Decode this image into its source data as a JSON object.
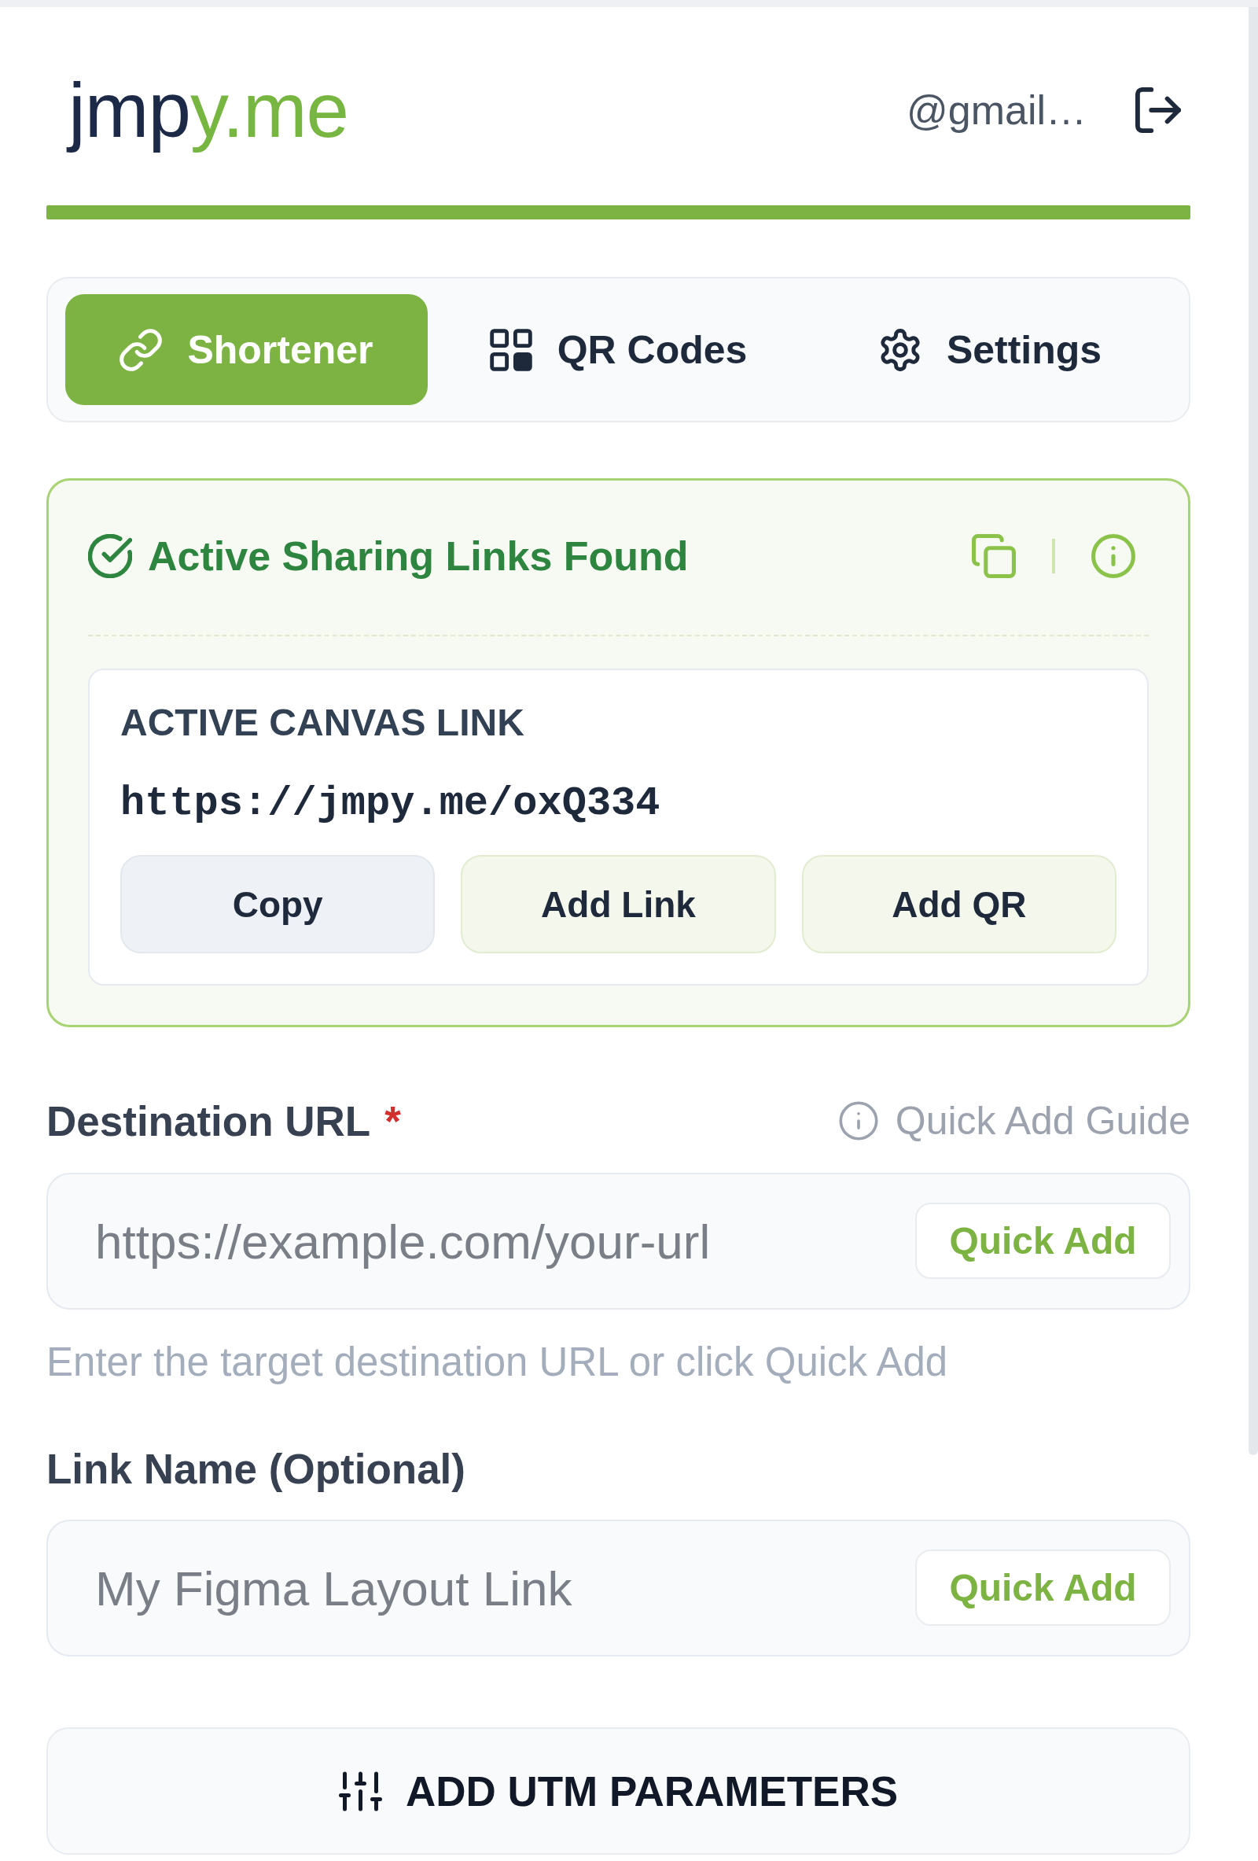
{
  "header": {
    "logo": {
      "text": "jmp",
      "accent_text": "y.me"
    },
    "account": "@gmail…"
  },
  "tabs": [
    {
      "label": "Shortener",
      "selected": true
    },
    {
      "label": "QR Codes",
      "selected": false
    },
    {
      "label": "Settings",
      "selected": false
    }
  ],
  "active_links": {
    "title": "Active Sharing Links Found",
    "link_label": "ACTIVE CANVAS LINK",
    "url": "https://jmpy.me/oxQ334",
    "buttons": [
      {
        "label": "Copy",
        "kind": "neutral"
      },
      {
        "label": "Add Link",
        "kind": "accent"
      },
      {
        "label": "Add QR",
        "kind": "accent"
      }
    ]
  },
  "destination": {
    "label": "Destination URL",
    "required_mark": "*",
    "guide_link": "Quick Add Guide",
    "placeholder": "https://example.com/your-url",
    "quick_add": "Quick Add",
    "hint": "Enter the target destination URL or click Quick Add"
  },
  "link_name": {
    "label": "Link Name (Optional)",
    "placeholder": "My Figma Layout Link",
    "quick_add": "Quick Add"
  },
  "utm_button": {
    "label": "ADD UTM PARAMETERS"
  }
}
